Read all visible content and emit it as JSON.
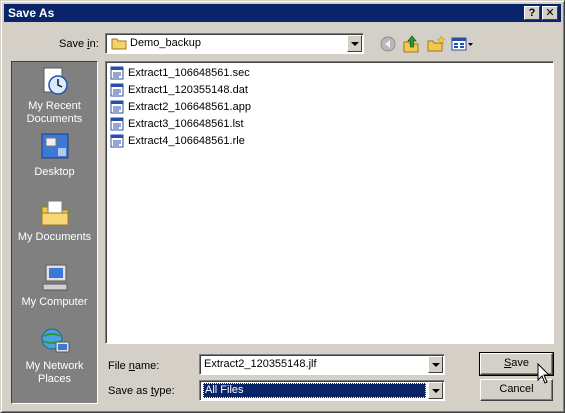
{
  "window": {
    "title": "Save As",
    "help_label": "?",
    "close_label": "✕"
  },
  "toolbar": {
    "save_in_prefix": "Save ",
    "save_in_key": "i",
    "save_in_suffix": "n:",
    "location": "Demo_backup",
    "icons": [
      "back-icon",
      "up-folder-icon",
      "new-folder-icon",
      "view-menu-icon"
    ]
  },
  "places": [
    {
      "label": "My Recent Documents",
      "icon": "recent-documents-icon"
    },
    {
      "label": "Desktop",
      "icon": "desktop-icon"
    },
    {
      "label": "My Documents",
      "icon": "my-documents-icon"
    },
    {
      "label": "My Computer",
      "icon": "my-computer-icon"
    },
    {
      "label": "My Network Places",
      "icon": "network-places-icon"
    }
  ],
  "files": [
    "Extract1_106648561.sec",
    "Extract1_120355148.dat",
    "Extract2_106648561.app",
    "Extract3_106648561.lst",
    "Extract4_106648561.rle"
  ],
  "form": {
    "filename_prefix": "File ",
    "filename_key": "n",
    "filename_suffix": "ame:",
    "filename_value": "Extract2_120355148.jlf",
    "savetype_prefix": "Save as ",
    "savetype_key": "t",
    "savetype_suffix": "ype:",
    "savetype_value": "All Files"
  },
  "buttons": {
    "save_key": "S",
    "save_rest": "ave",
    "cancel": "Cancel"
  },
  "colors": {
    "titlebar": "#0a246a",
    "places_bg": "#808080",
    "selection": "#0a246a"
  }
}
